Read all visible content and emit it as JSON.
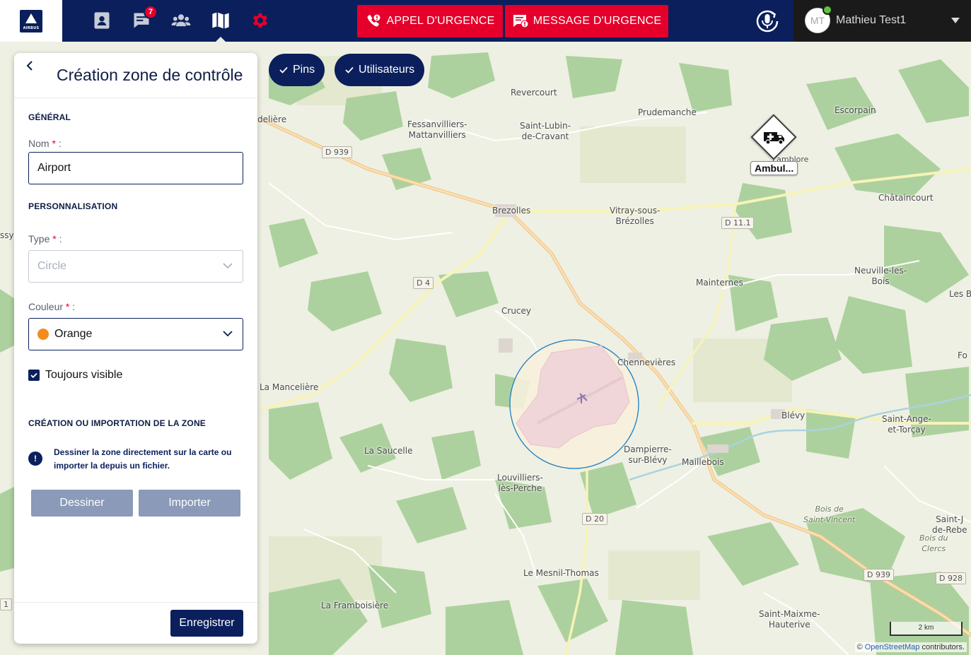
{
  "header": {
    "logo_text": "AIRBUS",
    "nav": [
      {
        "name": "contacts",
        "icon": "contact-card-icon"
      },
      {
        "name": "messages",
        "icon": "chat-icon",
        "badge": "7"
      },
      {
        "name": "groups",
        "icon": "users-icon"
      },
      {
        "name": "map",
        "icon": "map-icon",
        "active": true
      },
      {
        "name": "settings",
        "icon": "gear-icon",
        "color": "#e4002b"
      }
    ],
    "emergency_call_label": "APPEL D'URGENCE",
    "emergency_message_label": "MESSAGE D'URGENCE",
    "user": {
      "initials": "MT",
      "name": "Mathieu Test1",
      "status_color": "#5cc43a"
    }
  },
  "map": {
    "chips": [
      {
        "label": "Pins"
      },
      {
        "label": "Utilisateurs"
      }
    ],
    "marker_label": "Ambul...",
    "scale_label": "2 km",
    "attribution_prefix": "© ",
    "attribution_link": "OpenStreetMap",
    "attribution_suffix": " contributors.",
    "places": [
      {
        "text": "Revercourt"
      },
      {
        "text": "Prudemanche"
      },
      {
        "text": "Escorpain"
      },
      {
        "text": "Fessanvilliers-\nMattanvilliers"
      },
      {
        "text": "Saint-Lubin-\nde-Cravant"
      },
      {
        "text": "Lamblore"
      },
      {
        "text": "Brezolles"
      },
      {
        "text": "Vitray-sous-\nBrézolles"
      },
      {
        "text": "Châtaincourt"
      },
      {
        "text": "Neuville-les-\nBois"
      },
      {
        "text": "Mainternes"
      },
      {
        "text": "Crucey"
      },
      {
        "text": "Chennevières"
      },
      {
        "text": "La Mancelière"
      },
      {
        "text": "Blévy"
      },
      {
        "text": "Saint-Ange-\net-Torçay"
      },
      {
        "text": "La Saucelle"
      },
      {
        "text": "Dampierre-\nsur-Blévy"
      },
      {
        "text": "Maillebois"
      },
      {
        "text": "Louvilliers-\nlès-Perche"
      },
      {
        "text": "Le Mesnil-Thomas"
      },
      {
        "text": "La Framboisière"
      },
      {
        "text": "Saint-Maixme-\nHauterive"
      },
      {
        "text": "Les B"
      },
      {
        "text": "Fo"
      },
      {
        "text": "Saint-J\nde-Rebe"
      },
      {
        "text": "delière"
      },
      {
        "text": "ssy-"
      }
    ],
    "forest_labels": [
      {
        "text": "Bois de\nSaint-Vincent"
      },
      {
        "text": "Bois du\nClercs"
      }
    ],
    "roads": [
      "D 939",
      "D 11.1",
      "D 4",
      "D 20",
      "D 939",
      "D 928",
      "1"
    ],
    "zone_color": "#1a7fc4"
  },
  "panel": {
    "title": "Création zone de contrôle",
    "general_section": "GÉNÉRAL",
    "name_label": "Nom",
    "name_value": "Airport",
    "custom_section": "PERSONNALISATION",
    "type_label": "Type",
    "type_value": "Circle",
    "color_label": "Couleur",
    "color_value": "Orange",
    "color_hex": "#f28c1e",
    "required_marker": "*",
    "label_suffix": " :",
    "always_visible_label": "Toujours visible",
    "always_visible_checked": true,
    "zone_section": "CRÉATION OU IMPORTATION DE LA ZONE",
    "info_text": "Dessiner la zone directement sur la carte ou importer la depuis un fichier.",
    "info_icon": "!",
    "draw_button": "Dessiner",
    "import_button": "Importer",
    "save_button": "Enregistrer"
  }
}
